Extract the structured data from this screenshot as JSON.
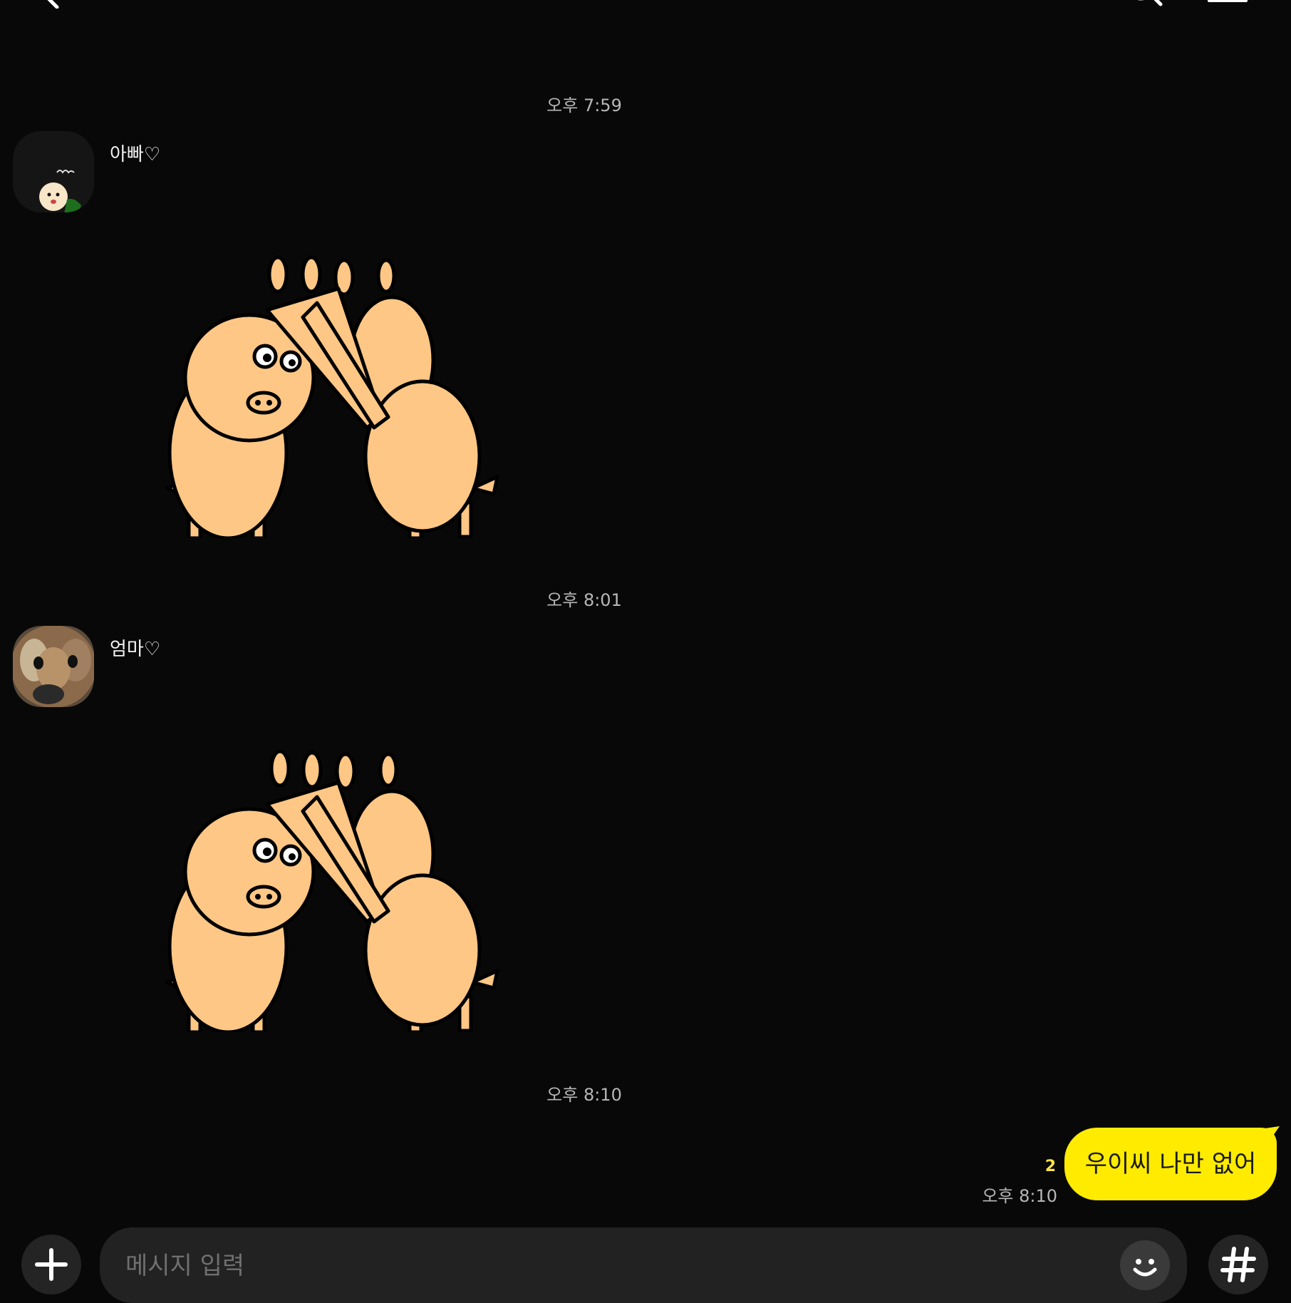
{
  "header": {
    "back_icon": "chevron-left-icon",
    "search_icon": "search-icon",
    "menu_icon": "hamburger-menu-icon"
  },
  "messages": [
    {
      "time": "오후 7:59",
      "sender": "아빠♡",
      "type": "sticker"
    },
    {
      "time": "오후 8:01",
      "sender": "엄마♡",
      "type": "sticker"
    },
    {
      "time": "오후 8:10"
    }
  ],
  "my_message": {
    "text": "우이씨 나만 없어",
    "unread_count": "2",
    "time": "오후 8:10"
  },
  "input": {
    "placeholder": "메시지 입력",
    "value": ""
  },
  "colors": {
    "background": "#080808",
    "my_bubble": "#ffeb00",
    "unread": "#ffe14a",
    "sticker_fill": "#ffc785"
  }
}
